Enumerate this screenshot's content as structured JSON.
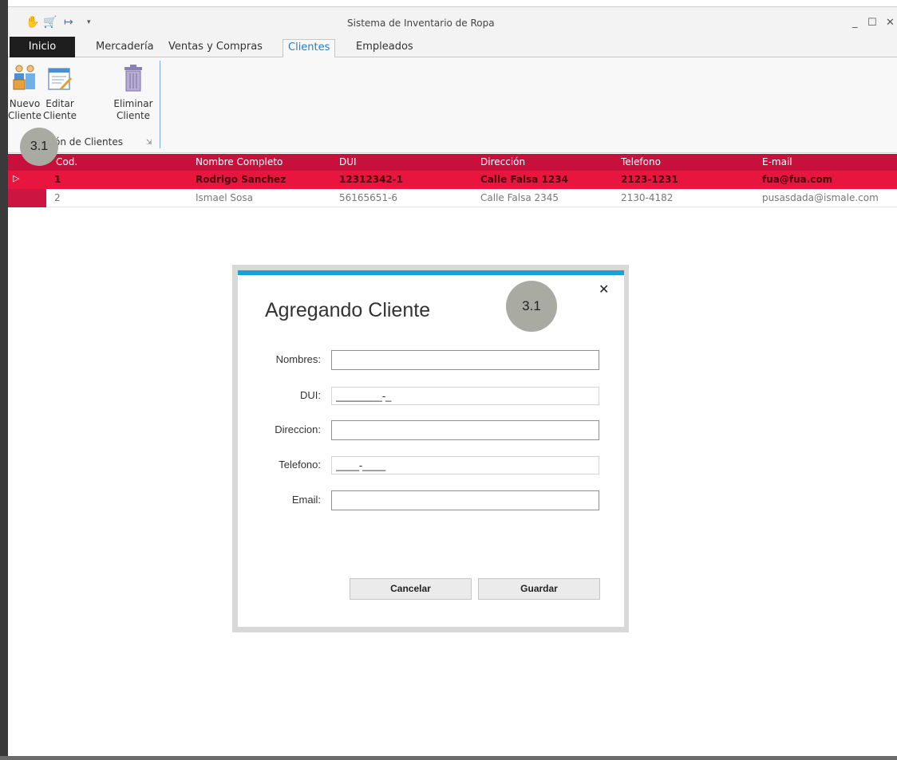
{
  "window": {
    "title": "Sistema de Inventario de Ropa"
  },
  "ribbon": {
    "tabs": [
      {
        "label": "Inicio"
      },
      {
        "label": "Mercadería"
      },
      {
        "label": "Ventas y Compras"
      },
      {
        "label": "Clientes"
      },
      {
        "label": "Empleados"
      }
    ],
    "active_tab": "Clientes",
    "buttons": {
      "nuevo": "Nuevo Cliente",
      "editar": "Editar Cliente",
      "eliminar": "Eliminar Cliente"
    },
    "group_label": "ón de Clientes"
  },
  "badges": {
    "a": "3.1",
    "b": "3.1"
  },
  "grid": {
    "headers": [
      "Cod.",
      "Nombre Completo",
      "DUI",
      "Dirección",
      "Telefono",
      "E-mail"
    ],
    "rows": [
      {
        "cod": "1",
        "nombre": "Rodrigo Sanchez",
        "dui": "12312342-1",
        "direccion": "Calle Falsa 1234",
        "telefono": "2123-1231",
        "email": "fua@fua.com"
      },
      {
        "cod": "2",
        "nombre": "Ismael Sosa",
        "dui": "56165651-6",
        "direccion": "Calle Falsa 2345",
        "telefono": "2130-4182",
        "email": "pusasdada@ismale.com"
      }
    ],
    "selected_row": 0
  },
  "dialog": {
    "title": "Agregando Cliente",
    "fields": {
      "nombres": {
        "label": "Nombres:",
        "value": ""
      },
      "dui": {
        "label": "DUI:",
        "value": "________-_"
      },
      "direccion": {
        "label": "Direccion:",
        "value": ""
      },
      "telefono": {
        "label": "Telefono:",
        "value": "____-____"
      },
      "email": {
        "label": "Email:",
        "value": ""
      }
    },
    "buttons": {
      "cancel": "Cancelar",
      "save": "Guardar"
    }
  },
  "colors": {
    "accent": "#1ba1d8",
    "grid_header": "#c8103c",
    "grid_selected": "#e8163f",
    "tab_active_text": "#2a78c9"
  }
}
